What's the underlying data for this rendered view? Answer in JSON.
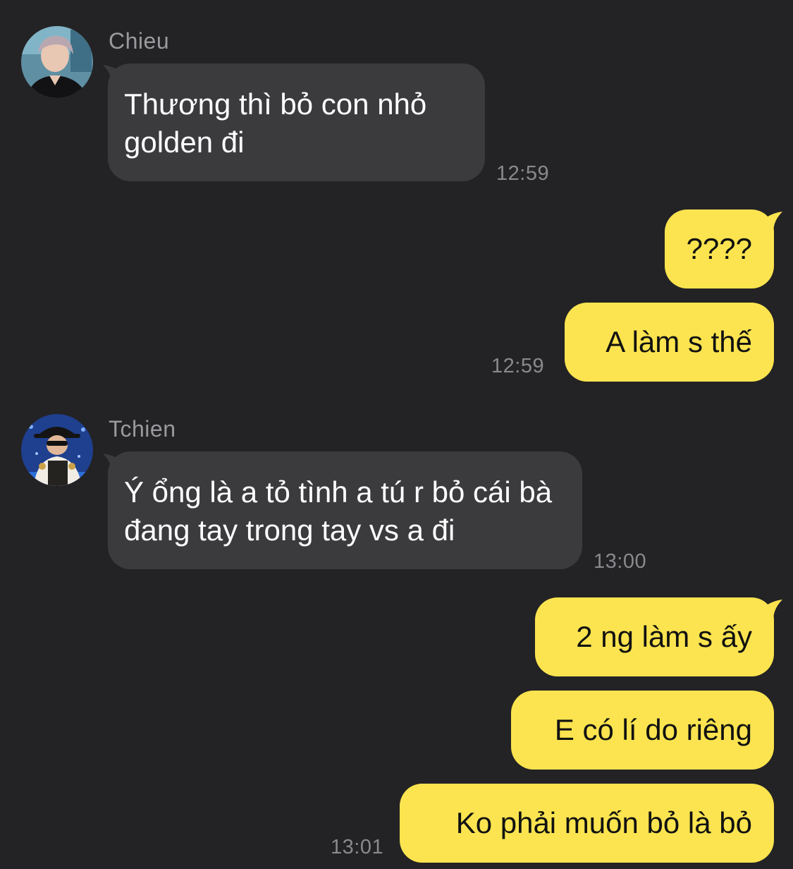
{
  "colors": {
    "background": "#232325",
    "incoming_bubble": "#3b3b3e",
    "outgoing_bubble": "#fbe44f",
    "timestamp": "#8a8a8e",
    "sender_name": "#9a9a9e"
  },
  "messages": [
    {
      "direction": "incoming",
      "sender": "Chieu",
      "avatar": "avatar-chieu",
      "text": "Thương thì bỏ con nhỏ golden đi",
      "time": "12:59"
    },
    {
      "direction": "outgoing",
      "texts": [
        "????",
        "A làm s thế"
      ],
      "time": "12:59"
    },
    {
      "direction": "incoming",
      "sender": "Tchien",
      "avatar": "avatar-tchien",
      "text": "Ý ổng là a tỏ tình a tú r bỏ cái bà đang tay trong tay vs a đi",
      "time": "13:00"
    },
    {
      "direction": "outgoing",
      "texts": [
        "2 ng làm s ấy",
        "E có lí do riêng",
        "Ko phải muốn bỏ là bỏ"
      ],
      "time": "13:01"
    }
  ]
}
